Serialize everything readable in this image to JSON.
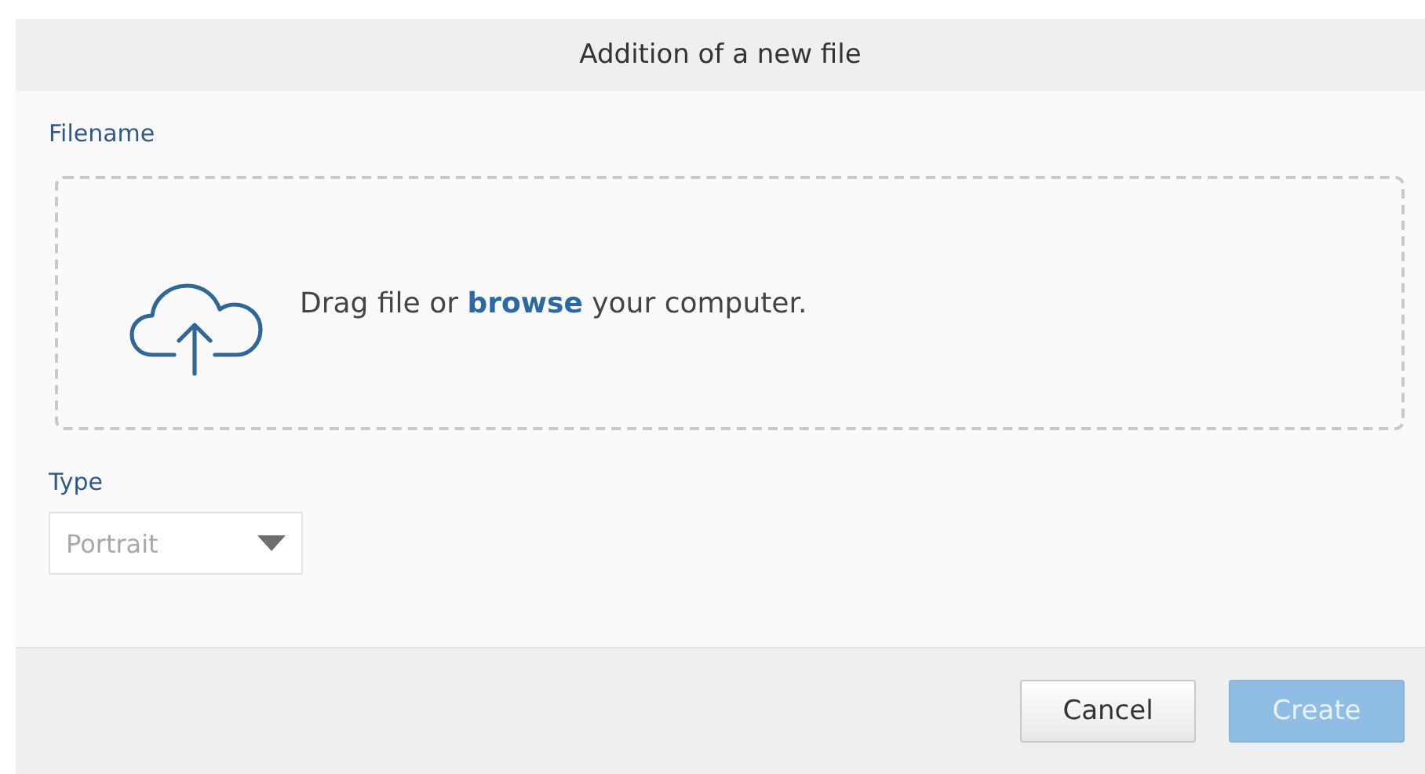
{
  "dialog": {
    "title": "Addition of a new file"
  },
  "filename": {
    "label": "Filename",
    "prompt_before": "Drag file or",
    "link": "browse",
    "prompt_after": "your computer."
  },
  "type": {
    "label": "Type",
    "value": "Portrait"
  },
  "buttons": [
    {
      "label": "Cancel",
      "kind": "secondary",
      "disabled": false
    },
    {
      "label": "Create",
      "kind": "primary",
      "disabled": true
    }
  ]
}
